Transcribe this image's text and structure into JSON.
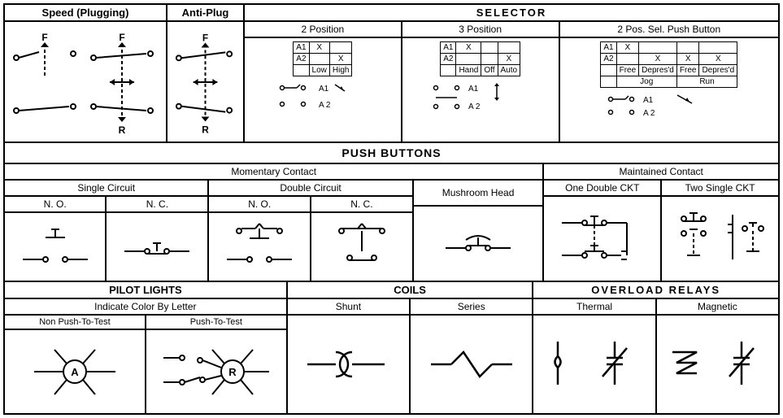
{
  "row1": {
    "speed_plugging": "Speed (Plugging)",
    "anti_plug": "Anti-Plug",
    "selector": "SELECTOR",
    "F": "F",
    "R": "R",
    "pos2": {
      "title": "2 Position",
      "a1": "A1",
      "a2": "A2",
      "x": "X",
      "low": "Low",
      "high": "High"
    },
    "pos3": {
      "title": "3 Position",
      "a1": "A1",
      "a2": "A2",
      "x": "X",
      "hand": "Hand",
      "off": "Off",
      "auto": "Auto"
    },
    "pb2": {
      "title": "2 Pos. Sel. Push Button",
      "a1": "A1",
      "a2": "A2",
      "x": "X",
      "free": "Free",
      "depres": "Depres'd",
      "jog": "Jog",
      "run": "Run"
    },
    "c_a1": "A1",
    "c_a2": "A 2"
  },
  "push_buttons": "PUSH BUTTONS",
  "pb": {
    "momentary": "Momentary Contact",
    "maintained": "Maintained Contact",
    "single": "Single Circuit",
    "double": "Double Circuit",
    "mushroom": "Mushroom Head",
    "one_double": "One Double CKT",
    "two_single": "Two Single CKT",
    "no": "N. O.",
    "nc": "N. C."
  },
  "bottom": {
    "pilot": "PILOT LIGHTS",
    "indicate": "Indicate Color By Letter",
    "non_push": "Non Push-To-Test",
    "push": "Push-To-Test",
    "A": "A",
    "R": "R",
    "coils": "COILS",
    "shunt": "Shunt",
    "series": "Series",
    "overload": "OVERLOAD  RELAYS",
    "thermal": "Thermal",
    "magnetic": "Magnetic"
  }
}
